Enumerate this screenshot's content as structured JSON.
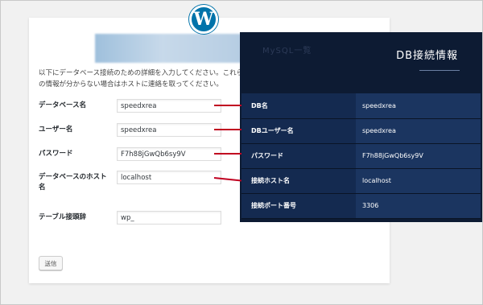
{
  "logo": {
    "glyph": "W"
  },
  "intro_text": "以下にデータベース接続のための詳細を入力してください。これらの情報が分からない場合はホストに連絡を取ってください。",
  "form": {
    "fields": [
      {
        "label": "データベース名",
        "value": "speedxrea"
      },
      {
        "label": "ユーザー名",
        "value": "speedxrea"
      },
      {
        "label": "パスワード",
        "value": "F7h88jGwQb6sy9V"
      },
      {
        "label": "データベースのホスト名",
        "value": "localhost"
      },
      {
        "label": "テーブル接頭辞",
        "value": "wp_"
      }
    ],
    "submit_label": "送信"
  },
  "db_panel": {
    "ghost_text": "MySQL一覧",
    "title": "DB接続情報",
    "rows": [
      {
        "key": "DB名",
        "value": "speedxrea"
      },
      {
        "key": "DBユーザー名",
        "value": "speedxrea"
      },
      {
        "key": "パスワード",
        "value": "F7h88jGwQb6sy9V"
      },
      {
        "key": "接続ホスト名",
        "value": "localhost"
      },
      {
        "key": "接続ポート番号",
        "value": "3306"
      }
    ]
  },
  "colors": {
    "wp_blue": "#0073aa",
    "panel_bg": "#0d1b33",
    "connector_red": "#c00020"
  }
}
